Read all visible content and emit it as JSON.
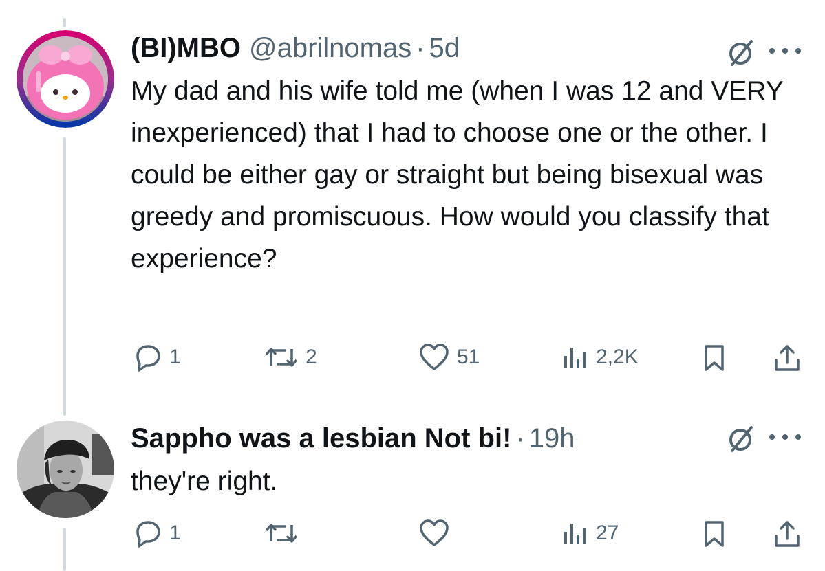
{
  "tweets": [
    {
      "display_name": "(BI)MBO",
      "handle": "@abrilnomas",
      "separator": "·",
      "time": "5d",
      "text": "My dad and his wife told me (when I was 12 and VERY inexperienced) that I had to choose one or the other. I could be either gay or straight but being bisexual was greedy and promiscuous. How would you classify that experience?",
      "replies": "1",
      "reposts": "2",
      "likes": "51",
      "views": "2,2K",
      "avatar_icon": "pink-bunny-avatar"
    },
    {
      "display_name": "Sappho was a lesbian Not bi!",
      "separator": "·",
      "time": "19h",
      "text": "they're right.",
      "replies": "1",
      "reposts": "",
      "likes": "",
      "views": "27",
      "avatar_icon": "person-photo-avatar"
    }
  ],
  "icons": {
    "grok": "slashed-circle-icon",
    "more": "more-dots-icon",
    "reply": "reply-bubble-icon",
    "repost": "repost-arrows-icon",
    "like": "heart-icon",
    "views": "bar-chart-icon",
    "bookmark": "bookmark-icon",
    "share": "share-icon"
  },
  "colors": {
    "text_primary": "#0f1419",
    "text_secondary": "#536471",
    "thread_line": "#cfd9de"
  }
}
